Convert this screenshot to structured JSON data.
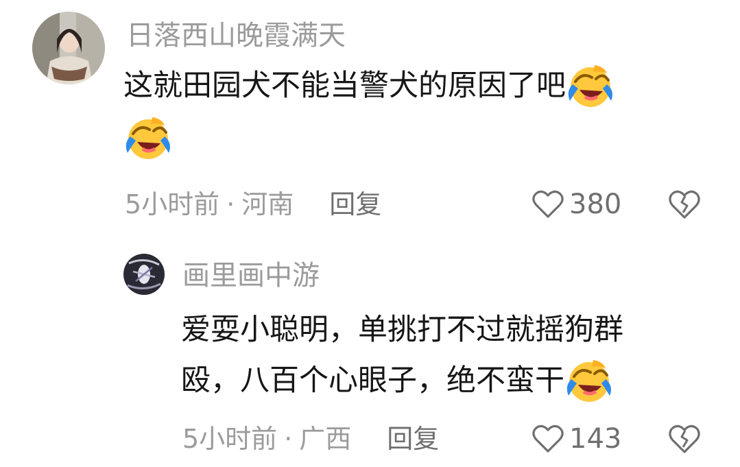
{
  "comments": [
    {
      "username": "日落西山晚霞满天",
      "text_line1": "这就田园犬不能当警犬的原因了吧",
      "emoji1": "laughing-crying-emoji",
      "emoji2": "laughing-crying-emoji",
      "time": "5小时前",
      "separator": "·",
      "location": "河南",
      "reply_label": "回复",
      "likes": "380"
    },
    {
      "username": "画里画中游",
      "text_line1": "爱耍小聪明，单挑打不过就摇狗群",
      "text_line2": "殴，八百个心眼子，绝不蛮干",
      "emoji1": "laughing-crying-emoji",
      "time": "5小时前",
      "separator": "·",
      "location": "广西",
      "reply_label": "回复",
      "likes": "143"
    }
  ],
  "icons": {
    "like": "heart-outline-icon",
    "dislike": "broken-heart-icon"
  },
  "colors": {
    "username": "#9b9b9b",
    "meta": "#9b9b9b",
    "text": "#161616",
    "emoji_face": "#FFC83D",
    "emoji_tears": "#2E8BEA"
  }
}
